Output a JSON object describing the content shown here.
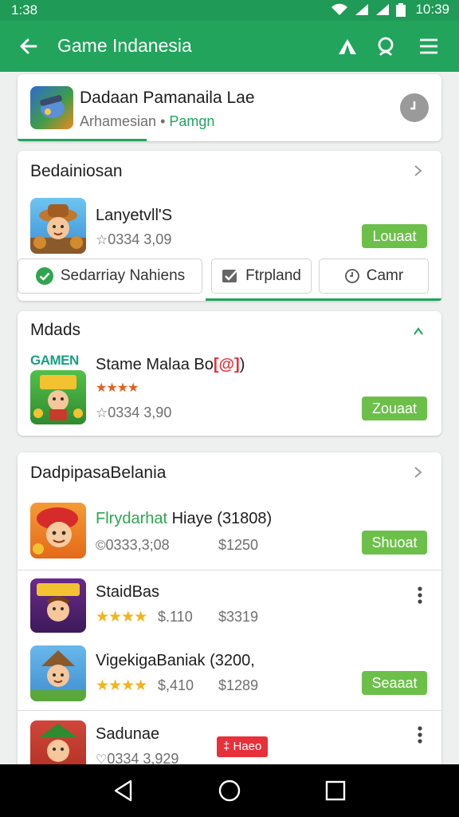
{
  "status": {
    "time": "1:38",
    "clock": "10:39"
  },
  "appbar": {
    "title": "Game Indanesia",
    "icons": [
      "arrow-back-icon",
      "tent-icon",
      "search-icon",
      "menu-icon"
    ]
  },
  "featured": {
    "name": "Dadaan Pamanaila Lae",
    "subtitle": "Arhamesian",
    "tag": "Pamgn",
    "separator": "•"
  },
  "section1": {
    "title": "Bedainiosan",
    "app": {
      "name": "Lanyetvll'S",
      "meta": "0334 3,09",
      "button": "Louaat"
    },
    "chips": [
      {
        "label": "Sedarriay Nahiens",
        "icon": "check-circle-icon"
      },
      {
        "label": "Ftrpland",
        "icon": "checkbox-icon"
      },
      {
        "label": "Camr",
        "icon": "clock-icon"
      }
    ]
  },
  "section2": {
    "title": "Mdads",
    "app": {
      "name": "Stame Malaa Bo",
      "badge": "[@]",
      "name_suffix": ")",
      "meta": "0334 3,90",
      "button": "Zouaat",
      "icon_text": "GAMEN",
      "rating": 4
    }
  },
  "section3": {
    "title": "DadpipasaBelania",
    "items": [
      {
        "name_green": "Flrydarhat",
        "name_rest": " Hiaye (31808)",
        "meta": "0333,3;08",
        "price": "$1250",
        "button": "Shuoat"
      },
      {
        "name": "StaidBas",
        "rating_text": "$.110",
        "price": "$3319",
        "rating": 4
      },
      {
        "name": "VigekigaBaniak (3200,",
        "rating_text": "$,410",
        "price": "$1289",
        "button": "Seaaat",
        "rating": 4
      },
      {
        "name": "Sadunae",
        "meta": "0334 3,929",
        "badge": "‡ Haeo"
      }
    ]
  },
  "colors": {
    "primary": "#22a45d",
    "accent": "#6cc04a",
    "star": "#f2b418",
    "badge": "#e8303a"
  }
}
